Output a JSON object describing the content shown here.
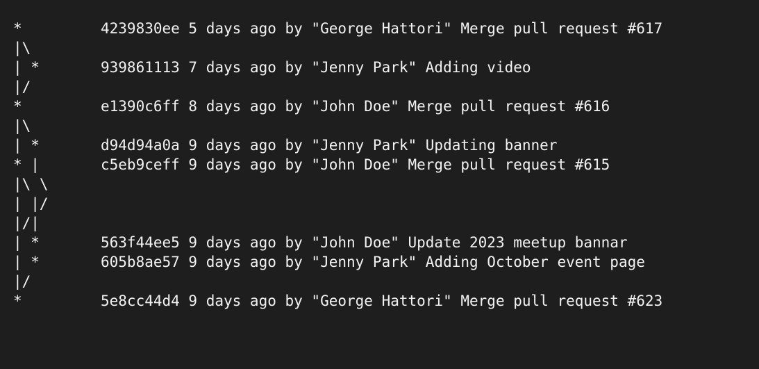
{
  "terminal": {
    "lines": [
      {
        "graph": "*",
        "commit": "4239830ee 5 days ago by \"George Hattori\" Merge pull request #617"
      },
      {
        "graph": "|\\",
        "commit": ""
      },
      {
        "graph": "| *",
        "commit": "939861113 7 days ago by \"Jenny Park\" Adding video"
      },
      {
        "graph": "|/",
        "commit": ""
      },
      {
        "graph": "*",
        "commit": "e1390c6ff 8 days ago by \"John Doe\" Merge pull request #616"
      },
      {
        "graph": "|\\",
        "commit": ""
      },
      {
        "graph": "| *",
        "commit": "d94d94a0a 9 days ago by \"Jenny Park\" Updating banner"
      },
      {
        "graph": "* |",
        "commit": "c5eb9ceff 9 days ago by \"John Doe\" Merge pull request #615"
      },
      {
        "graph": "|\\ \\",
        "commit": ""
      },
      {
        "graph": "| |/",
        "commit": ""
      },
      {
        "graph": "|/|",
        "commit": ""
      },
      {
        "graph": "| *",
        "commit": "563f44ee5 9 days ago by \"John Doe\" Update 2023 meetup bannar"
      },
      {
        "graph": "| *",
        "commit": "605b8ae57 9 days ago by \"Jenny Park\" Adding October event page"
      },
      {
        "graph": "|/",
        "commit": ""
      },
      {
        "graph": "*",
        "commit": "5e8cc44d4 9 days ago by \"George Hattori\" Merge pull request #623"
      }
    ]
  }
}
